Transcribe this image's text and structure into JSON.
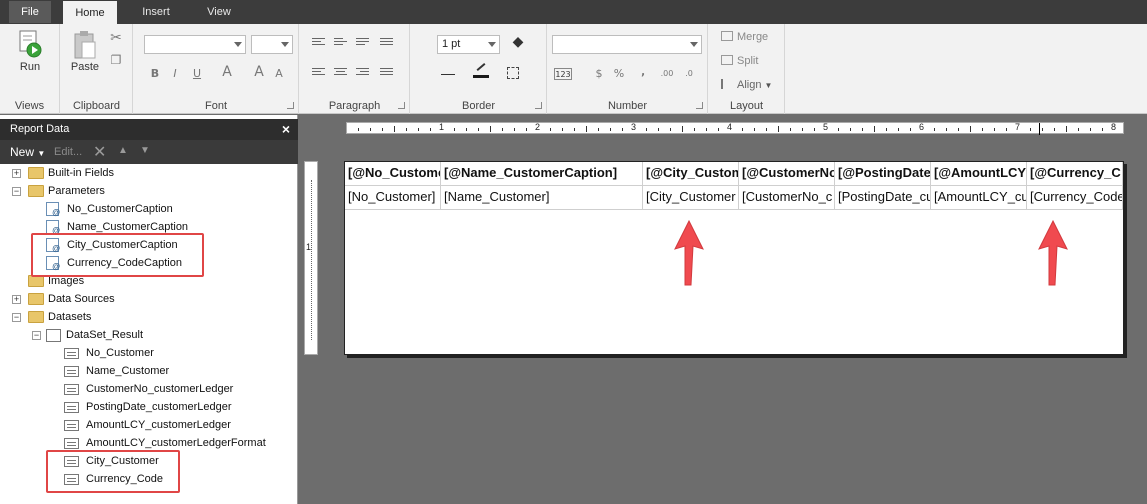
{
  "ribbon_tabs": {
    "file": "File",
    "home": "Home",
    "insert": "Insert",
    "view": "View"
  },
  "ribbon": {
    "views": {
      "run": "Run",
      "label": "Views"
    },
    "clipboard": {
      "paste": "Paste",
      "label": "Clipboard"
    },
    "font": {
      "label": "Font",
      "bold": "B",
      "italic": "I",
      "underline": "U",
      "font_color": "A",
      "grow": "A",
      "shrink": "A"
    },
    "paragraph": {
      "label": "Paragraph"
    },
    "border": {
      "width_value": "1 pt",
      "label": "Border"
    },
    "number": {
      "label": "Number",
      "placeholders": "123",
      "currency": "$",
      "percent": "%",
      "comma": "‚"
    },
    "layout": {
      "merge": "Merge",
      "split": "Split",
      "align": "Align",
      "label": "Layout"
    }
  },
  "report_data_panel": {
    "title": "Report Data",
    "close_icon": "×",
    "toolbar": {
      "new_label": "New",
      "edit_label": "Edit..."
    },
    "tree": {
      "builtin_fields": "Built-in Fields",
      "parameters": "Parameters",
      "parameter_items": [
        "No_CustomerCaption",
        "Name_CustomerCaption",
        "City_CustomerCaption",
        "Currency_CodeCaption"
      ],
      "images": "Images",
      "data_sources": "Data Sources",
      "datasets": "Datasets",
      "dataset_name": "DataSet_Result",
      "fields": [
        "No_Customer",
        "Name_Customer",
        "CustomerNo_customerLedger",
        "PostingDate_customerLedger",
        "AmountLCY_customerLedger",
        "AmountLCY_customerLedgerFormat",
        "City_Customer",
        "Currency_Code"
      ]
    }
  },
  "ruler": {
    "numbers": [
      "1",
      "2",
      "3",
      "4",
      "5",
      "6",
      "7",
      "8"
    ]
  },
  "report_table": {
    "headers": [
      "[@No_Custome",
      "[@Name_CustomerCaption]",
      "[@City_Custom",
      "[@CustomerNo",
      "[@PostingDate",
      "[@AmountLCY",
      "[@Currency_C"
    ],
    "row": [
      "[No_Customer]",
      "[Name_Customer]",
      "[City_Customer",
      "[CustomerNo_c",
      "[PostingDate_cu",
      "[AmountLCY_cu",
      "[Currency_Code"
    ]
  },
  "colors": {
    "highlight": "#e04646",
    "arrow": "#f04a4f",
    "ribbon_bg": "#f2f2f2",
    "dark_bar": "#2d2d2d"
  }
}
